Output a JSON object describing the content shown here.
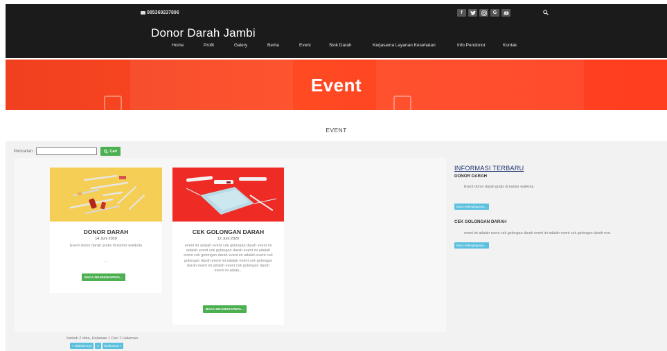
{
  "topbar": {
    "phone": "085369237896",
    "socials": [
      "f",
      "t",
      "ig",
      "G",
      "yt"
    ]
  },
  "brand": {
    "name": "Donor Darah Jambi"
  },
  "nav": {
    "items": [
      "Home",
      "Profil",
      "Galery",
      "Berita",
      "Event",
      "Stok Darah",
      "Kerjasama Layanan Kesehatan",
      "Info Pendonor",
      "Kontak"
    ]
  },
  "hero": {
    "title": "Event"
  },
  "section": {
    "title": "EVENT"
  },
  "search": {
    "label": "Pencarian :",
    "value": "",
    "button": "Cari"
  },
  "cards": [
    {
      "title": "DONOR DARAH",
      "date": "14 Juni 2020",
      "desc": "Event donor darah gratis di kantor walikota",
      "more": "...",
      "button": "BACA SELENGKAPNYA..."
    },
    {
      "title": "CEK GOLONGAN DARAH",
      "date": "12 Juni 2020",
      "desc": "event ini adalah event cek golongan darah event ini adalah event cek golongan darah event ini adalah event cek golongan darah event ini adalah event cek golongan darah event ini adalah event cek golongan darah event ini adalah event cek golongan darah event ini adala...",
      "more": "",
      "button": "BACA SELENGKAPNYA..."
    }
  ],
  "sidebar": {
    "heading": "INFORMASI TERBARU",
    "items": [
      {
        "title": "DONOR DARAH",
        "desc": "Event donor darah gratis di kantor walikota",
        "dot": ".",
        "button": "Baca Selengkapnya..."
      },
      {
        "title": "CEK GOLONGAN DARAH",
        "desc": "event ini adalah event cek golongan darah event ini adalah event cek golongan darah eve.",
        "button": "Baca Selengkapnya..."
      }
    ]
  },
  "pagination": {
    "info": "Jumlah 2 data, Halaman 1 Dari 1 Halaman",
    "prev": "« sebelumnya",
    "page": "1",
    "next": "berikutnya »"
  }
}
